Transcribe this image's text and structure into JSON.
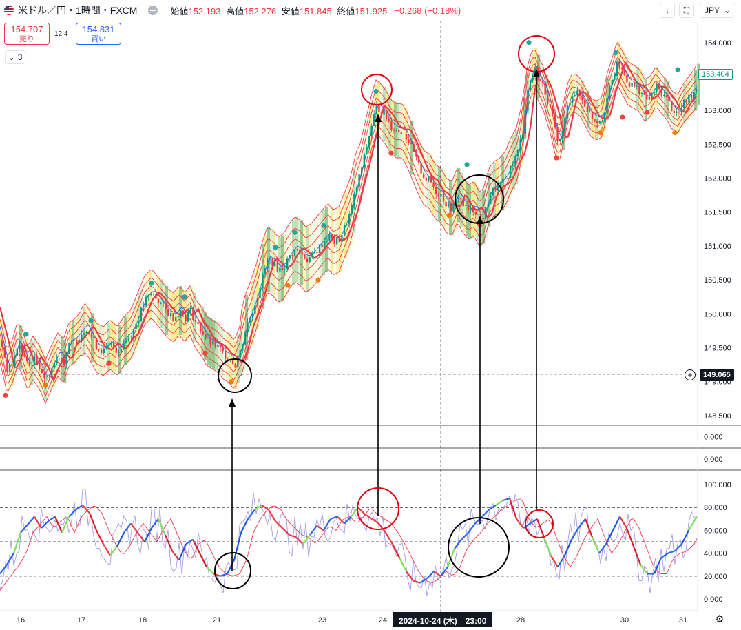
{
  "header": {
    "symbol": "米ドル／円・1時間・FXCM",
    "open_label": "始値",
    "open": "152.193",
    "high_label": "高値",
    "high": "152.276",
    "low_label": "安値",
    "low": "151.845",
    "close_label": "終値",
    "close": "151.925",
    "change": "−0.268 (−0.18%)"
  },
  "trade": {
    "sell_price": "154.707",
    "sell_label": "売り",
    "spread": "12.4",
    "buy_price": "154.831",
    "buy_label": "買い"
  },
  "indicator_count": "3",
  "toolbar": {
    "currency": "JPY"
  },
  "tags": {
    "last_price": "153.404",
    "crosshair_price": "149.065",
    "crosshair_date": "2024-10-24 (木)　23:00"
  },
  "colors": {
    "up": "#089981",
    "down": "#f23645",
    "accent": "#2962ff"
  },
  "chart_data": {
    "type": "candlestick",
    "y_axis": [
      "154.000",
      "153.500",
      "153.000",
      "152.500",
      "152.000",
      "151.500",
      "151.000",
      "150.500",
      "150.000",
      "149.500",
      "149.000",
      "148.500"
    ],
    "ylim": [
      148.55,
      154.15
    ],
    "x_ticks": [
      "16",
      "17",
      "18",
      "21",
      "23",
      "24",
      "28",
      "30",
      "31"
    ],
    "sub_panes": [
      {
        "axis": [
          "0.000"
        ]
      },
      {
        "axis": [
          "0.000"
        ]
      },
      {
        "axis": [
          "100.000",
          "80.000",
          "60.000",
          "40.000",
          "20.000",
          "0.000"
        ],
        "levels": [
          80,
          50,
          20
        ]
      }
    ],
    "price_path": [
      [
        0,
        149.6
      ],
      [
        5,
        149.4
      ],
      [
        10,
        149.15
      ],
      [
        18,
        149.3
      ],
      [
        25,
        149.55
      ],
      [
        32,
        149.45
      ],
      [
        40,
        149.2
      ],
      [
        48,
        149.35
      ],
      [
        58,
        149.2
      ],
      [
        66,
        149.0
      ],
      [
        74,
        149.2
      ],
      [
        84,
        149.4
      ],
      [
        92,
        149.3
      ],
      [
        100,
        149.55
      ],
      [
        108,
        149.6
      ],
      [
        116,
        149.7
      ],
      [
        124,
        149.8
      ],
      [
        132,
        149.65
      ],
      [
        140,
        149.5
      ],
      [
        150,
        149.45
      ],
      [
        160,
        149.55
      ],
      [
        170,
        149.45
      ],
      [
        180,
        149.6
      ],
      [
        190,
        149.7
      ],
      [
        200,
        149.95
      ],
      [
        210,
        150.2
      ],
      [
        220,
        150.3
      ],
      [
        228,
        150.2
      ],
      [
        236,
        150.1
      ],
      [
        244,
        150.0
      ],
      [
        252,
        149.95
      ],
      [
        260,
        150.05
      ],
      [
        268,
        149.95
      ],
      [
        276,
        150.05
      ],
      [
        284,
        149.85
      ],
      [
        292,
        149.75
      ],
      [
        300,
        149.6
      ],
      [
        308,
        149.55
      ],
      [
        316,
        149.5
      ],
      [
        324,
        149.4
      ],
      [
        332,
        149.35
      ],
      [
        340,
        149.25
      ],
      [
        348,
        149.45
      ],
      [
        356,
        149.8
      ],
      [
        364,
        150.0
      ],
      [
        372,
        150.25
      ],
      [
        380,
        150.55
      ],
      [
        388,
        150.8
      ],
      [
        396,
        150.75
      ],
      [
        404,
        150.65
      ],
      [
        412,
        150.7
      ],
      [
        420,
        150.85
      ],
      [
        428,
        150.95
      ],
      [
        436,
        150.9
      ],
      [
        444,
        150.8
      ],
      [
        452,
        150.85
      ],
      [
        460,
        150.95
      ],
      [
        468,
        151.05
      ],
      [
        476,
        151.15
      ],
      [
        484,
        151.05
      ],
      [
        492,
        151.1
      ],
      [
        500,
        151.3
      ],
      [
        508,
        151.5
      ],
      [
        516,
        151.85
      ],
      [
        524,
        152.15
      ],
      [
        532,
        152.5
      ],
      [
        540,
        152.85
      ],
      [
        546,
        153.05
      ],
      [
        552,
        153.0
      ],
      [
        560,
        152.9
      ],
      [
        568,
        152.75
      ],
      [
        576,
        152.7
      ],
      [
        584,
        152.7
      ],
      [
        592,
        152.55
      ],
      [
        600,
        152.35
      ],
      [
        608,
        152.15
      ],
      [
        616,
        152.0
      ],
      [
        624,
        151.95
      ],
      [
        632,
        151.8
      ],
      [
        640,
        151.75
      ],
      [
        648,
        151.6
      ],
      [
        656,
        151.55
      ],
      [
        664,
        151.75
      ],
      [
        672,
        151.6
      ],
      [
        680,
        151.5
      ],
      [
        688,
        151.55
      ],
      [
        696,
        151.4
      ],
      [
        702,
        151.45
      ],
      [
        710,
        151.75
      ],
      [
        718,
        151.85
      ],
      [
        726,
        151.9
      ],
      [
        734,
        152.0
      ],
      [
        742,
        152.2
      ],
      [
        750,
        152.35
      ],
      [
        758,
        152.7
      ],
      [
        764,
        153.25
      ],
      [
        770,
        153.5
      ],
      [
        776,
        153.6
      ],
      [
        782,
        153.45
      ],
      [
        788,
        153.35
      ],
      [
        794,
        153.15
      ],
      [
        800,
        152.95
      ],
      [
        806,
        152.65
      ],
      [
        812,
        152.55
      ],
      [
        818,
        152.8
      ],
      [
        824,
        153.1
      ],
      [
        830,
        153.25
      ],
      [
        836,
        153.25
      ],
      [
        842,
        153.2
      ],
      [
        850,
        153.05
      ],
      [
        858,
        152.9
      ],
      [
        866,
        152.85
      ],
      [
        874,
        152.9
      ],
      [
        882,
        153.25
      ],
      [
        890,
        153.5
      ],
      [
        896,
        153.7
      ],
      [
        904,
        153.55
      ],
      [
        912,
        153.4
      ],
      [
        920,
        153.35
      ],
      [
        928,
        153.3
      ],
      [
        936,
        153.15
      ],
      [
        944,
        153.2
      ],
      [
        952,
        153.35
      ],
      [
        960,
        153.25
      ],
      [
        968,
        153.15
      ],
      [
        976,
        153.0
      ],
      [
        984,
        152.95
      ],
      [
        992,
        153.1
      ],
      [
        1000,
        153.2
      ],
      [
        1008,
        153.3
      ],
      [
        1012,
        153.38
      ]
    ],
    "oscillator_path": [
      [
        0,
        22
      ],
      [
        10,
        30
      ],
      [
        20,
        40
      ],
      [
        30,
        58
      ],
      [
        40,
        65
      ],
      [
        50,
        72
      ],
      [
        60,
        62
      ],
      [
        70,
        68
      ],
      [
        80,
        72
      ],
      [
        90,
        58
      ],
      [
        100,
        72
      ],
      [
        110,
        78
      ],
      [
        120,
        82
      ],
      [
        130,
        75
      ],
      [
        140,
        60
      ],
      [
        150,
        48
      ],
      [
        160,
        38
      ],
      [
        170,
        46
      ],
      [
        180,
        58
      ],
      [
        190,
        66
      ],
      [
        200,
        58
      ],
      [
        210,
        50
      ],
      [
        220,
        62
      ],
      [
        230,
        70
      ],
      [
        240,
        56
      ],
      [
        250,
        42
      ],
      [
        260,
        34
      ],
      [
        270,
        48
      ],
      [
        280,
        52
      ],
      [
        290,
        40
      ],
      [
        300,
        28
      ],
      [
        310,
        22
      ],
      [
        320,
        20
      ],
      [
        330,
        22
      ],
      [
        340,
        34
      ],
      [
        350,
        58
      ],
      [
        360,
        70
      ],
      [
        370,
        78
      ],
      [
        380,
        82
      ],
      [
        390,
        78
      ],
      [
        400,
        68
      ],
      [
        410,
        62
      ],
      [
        420,
        56
      ],
      [
        430,
        54
      ],
      [
        440,
        48
      ],
      [
        450,
        56
      ],
      [
        460,
        64
      ],
      [
        470,
        60
      ],
      [
        480,
        70
      ],
      [
        490,
        72
      ],
      [
        500,
        66
      ],
      [
        510,
        72
      ],
      [
        520,
        80
      ],
      [
        530,
        74
      ],
      [
        540,
        70
      ],
      [
        550,
        66
      ],
      [
        560,
        58
      ],
      [
        570,
        48
      ],
      [
        580,
        36
      ],
      [
        590,
        24
      ],
      [
        600,
        16
      ],
      [
        610,
        14
      ],
      [
        620,
        18
      ],
      [
        630,
        24
      ],
      [
        640,
        20
      ],
      [
        650,
        28
      ],
      [
        660,
        44
      ],
      [
        670,
        52
      ],
      [
        680,
        58
      ],
      [
        690,
        66
      ],
      [
        700,
        72
      ],
      [
        710,
        78
      ],
      [
        720,
        82
      ],
      [
        730,
        86
      ],
      [
        740,
        88
      ],
      [
        750,
        70
      ],
      [
        760,
        62
      ],
      [
        770,
        66
      ],
      [
        780,
        70
      ],
      [
        790,
        54
      ],
      [
        800,
        38
      ],
      [
        810,
        28
      ],
      [
        820,
        38
      ],
      [
        830,
        52
      ],
      [
        840,
        62
      ],
      [
        850,
        70
      ],
      [
        860,
        54
      ],
      [
        870,
        40
      ],
      [
        880,
        48
      ],
      [
        890,
        60
      ],
      [
        900,
        72
      ],
      [
        910,
        62
      ],
      [
        920,
        46
      ],
      [
        930,
        30
      ],
      [
        940,
        22
      ],
      [
        950,
        22
      ],
      [
        960,
        36
      ],
      [
        970,
        40
      ],
      [
        980,
        42
      ],
      [
        990,
        48
      ],
      [
        1000,
        60
      ],
      [
        1012,
        72
      ]
    ]
  }
}
